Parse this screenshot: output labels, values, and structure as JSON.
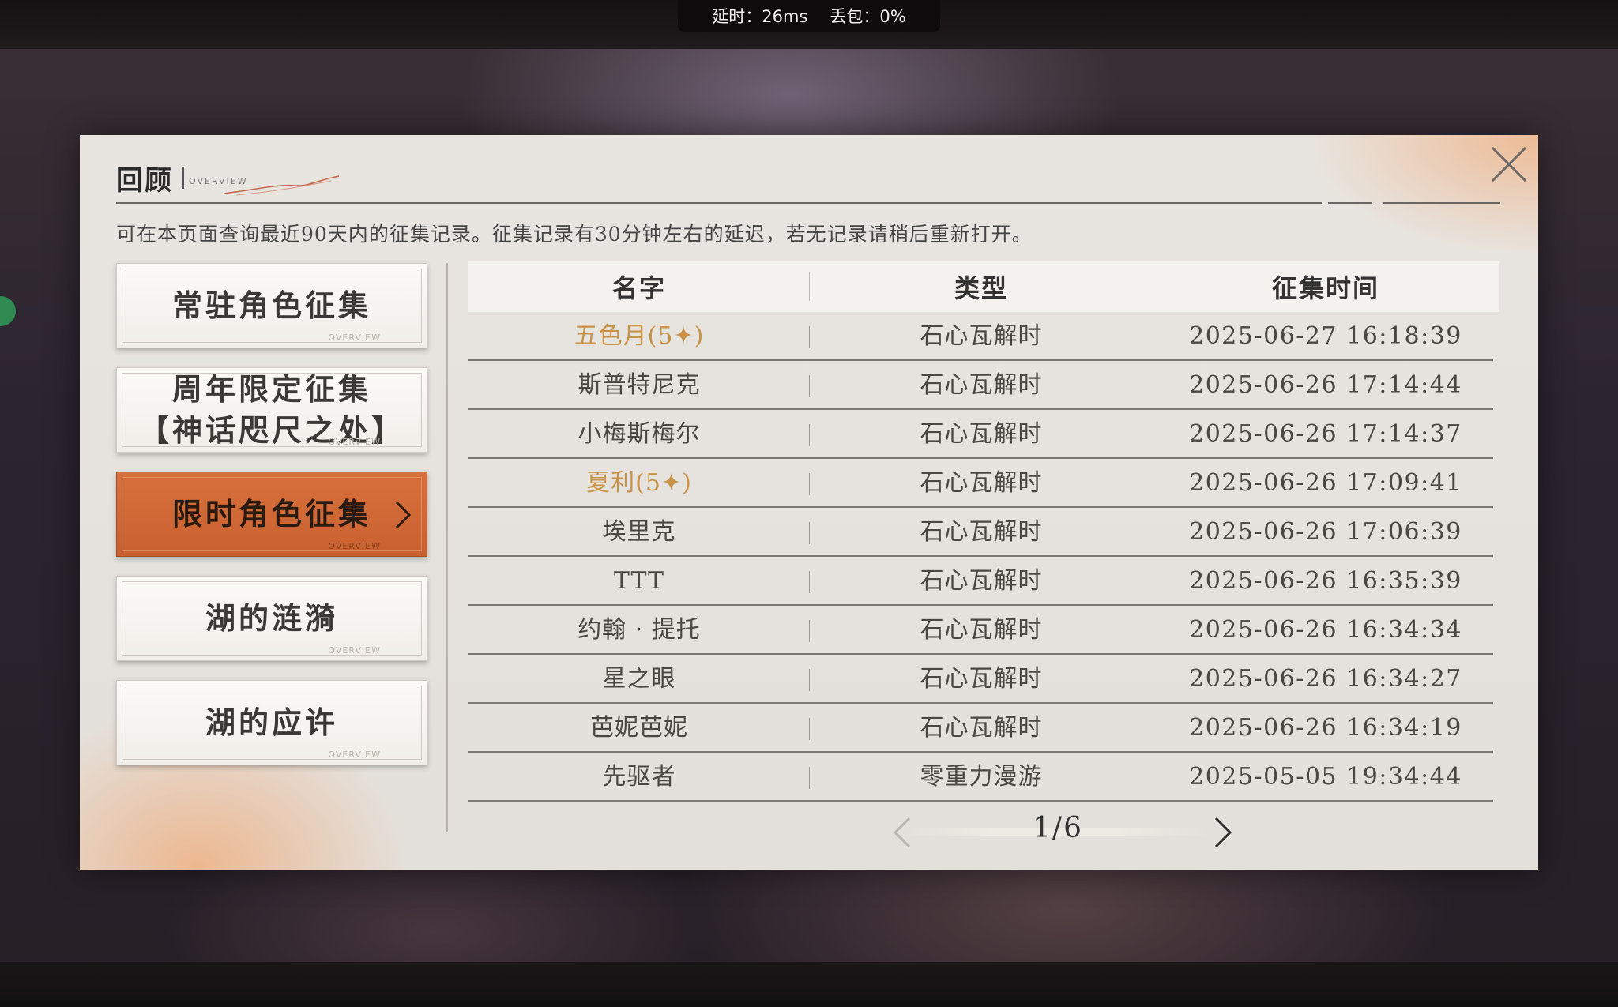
{
  "status_bar": {
    "latency": "延时：26ms",
    "packet_loss": "丢包：0%"
  },
  "panel": {
    "title": "回顾",
    "subtitle": "OVERVIEW",
    "notice": "可在本页面查询最近90天内的征集记录。征集记录有30分钟左右的延迟，若无记录请稍后重新打开。"
  },
  "tabs": [
    {
      "label": "常驻角色征集",
      "footer": "OVERVIEW",
      "active": false
    },
    {
      "label": "周年限定征集\n【神话咫尺之处】",
      "footer": "OVERVIEW",
      "active": false
    },
    {
      "label": "限时角色征集",
      "footer": "OVERVIEW",
      "active": true
    },
    {
      "label": "湖的涟漪",
      "footer": "OVERVIEW",
      "active": false
    },
    {
      "label": "湖的应许",
      "footer": "OVERVIEW",
      "active": false
    }
  ],
  "table": {
    "headers": {
      "name": "名字",
      "type": "类型",
      "time": "征集时间"
    },
    "rows": [
      {
        "name": "五色月(5✦)",
        "type": "石心瓦解时",
        "time": "2025-06-27 16:18:39",
        "highlight": true
      },
      {
        "name": "斯普特尼克",
        "type": "石心瓦解时",
        "time": "2025-06-26 17:14:44",
        "highlight": false
      },
      {
        "name": "小梅斯梅尔",
        "type": "石心瓦解时",
        "time": "2025-06-26 17:14:37",
        "highlight": false
      },
      {
        "name": "夏利(5✦)",
        "type": "石心瓦解时",
        "time": "2025-06-26 17:09:41",
        "highlight": true
      },
      {
        "name": "埃里克",
        "type": "石心瓦解时",
        "time": "2025-06-26 17:06:39",
        "highlight": false
      },
      {
        "name": "TTT",
        "type": "石心瓦解时",
        "time": "2025-06-26 16:35:39",
        "highlight": false
      },
      {
        "name": "约翰 · 提托",
        "type": "石心瓦解时",
        "time": "2025-06-26 16:34:34",
        "highlight": false
      },
      {
        "name": "星之眼",
        "type": "石心瓦解时",
        "time": "2025-06-26 16:34:27",
        "highlight": false
      },
      {
        "name": "芭妮芭妮",
        "type": "石心瓦解时",
        "time": "2025-06-26 16:34:19",
        "highlight": false
      },
      {
        "name": "先驱者",
        "type": "零重力漫游",
        "time": "2025-05-05 19:34:44",
        "highlight": false
      }
    ]
  },
  "pager": {
    "label": "1/6"
  },
  "colors": {
    "accent": "#cf6833",
    "highlight_gold": "#c99247"
  },
  "icons": {
    "close": "close-icon",
    "prev": "chevron-left-icon",
    "next": "chevron-right-icon",
    "tab_arrow": "chevron-right-icon"
  }
}
